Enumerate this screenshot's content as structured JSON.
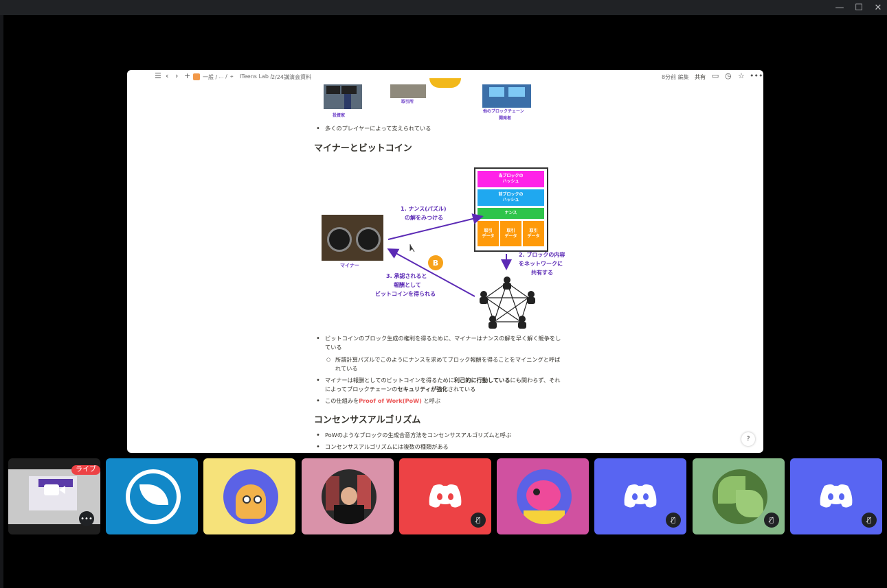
{
  "window": {
    "minimize_icon": "minimize-icon",
    "maximize_icon": "maximize-icon",
    "close_icon": "close-icon"
  },
  "notion": {
    "breadcrumb": [
      "一般 /",
      "... /",
      "ITeens Lab /",
      "2/24講演会資料"
    ],
    "edited": "8分前 編集",
    "share_label": "共有"
  },
  "top_diagram": {
    "labels": [
      "投資家",
      "取引所",
      "他のブロックチェーン",
      "開発者"
    ]
  },
  "doc": {
    "bullet_players": "多くのプレイヤーによって支えられている",
    "heading_miner": "マイナーとビットコイン",
    "bullet1_a": "ビットコインのブロック生成の権利を得るために、マイナーはナンスの解を早く解く競争をし",
    "bullet1_b": "ている",
    "sub1_a": "所謂計算パズルでこのようにナンスを求めてブロック報酬を得ることをマイニングと呼ば",
    "sub1_b": "れている",
    "bullet2_a1": "マイナーは報酬としてのビットコインを得るために",
    "bullet2_a2": "利己的に行動している",
    "bullet2_a3": "にも関わらず、それ",
    "bullet2_b1": "によってブロックチェーンの",
    "bullet2_b2": "セキュリティが強化",
    "bullet2_b3": "されている",
    "bullet3_a": "この仕組みを",
    "bullet3_b": "Proof of Work(PoW)",
    "bullet3_c": " と呼ぶ",
    "heading_consensus": "コンセンサスアルゴリズム",
    "bullet4": "PoWのようなブロックの生成合意方法をコンセンサスアルゴリズムと呼ぶ",
    "bullet5": "コンセンサスアルゴリズムには複数の種類がある"
  },
  "miner_diagram": {
    "miner_label": "マイナー",
    "block_prev_hash_this": "当ブロックの\nハッシュ",
    "block_prev_hash": "前ブロックの\nハッシュ",
    "block_nonce": "ナンス",
    "block_tx": "取引\nデータ",
    "step1_a": "1. ナンス(パズル)",
    "step1_b": "の解をみつける",
    "step2_a": "2. ブロックの内容",
    "step2_b": "をネットワークに",
    "step2_c": "共有する",
    "step3_a": "3. 承認されると",
    "step3_b": "報酬として",
    "step3_c": "ビットコインを得られる",
    "colors": {
      "magenta": "#ff22e8",
      "cyan": "#1fa8f0",
      "green": "#2ec44a",
      "orange": "#ff9a0a",
      "arrow": "#5b2ab5"
    }
  },
  "tiles": {
    "live_label": "ライブ",
    "colors": [
      "#1f1f1f",
      "#1288c8",
      "#f6e27a",
      "#d992a9",
      "#ed4245",
      "#d051a0",
      "#5865f2",
      "#85b888",
      "#5865f2"
    ]
  }
}
